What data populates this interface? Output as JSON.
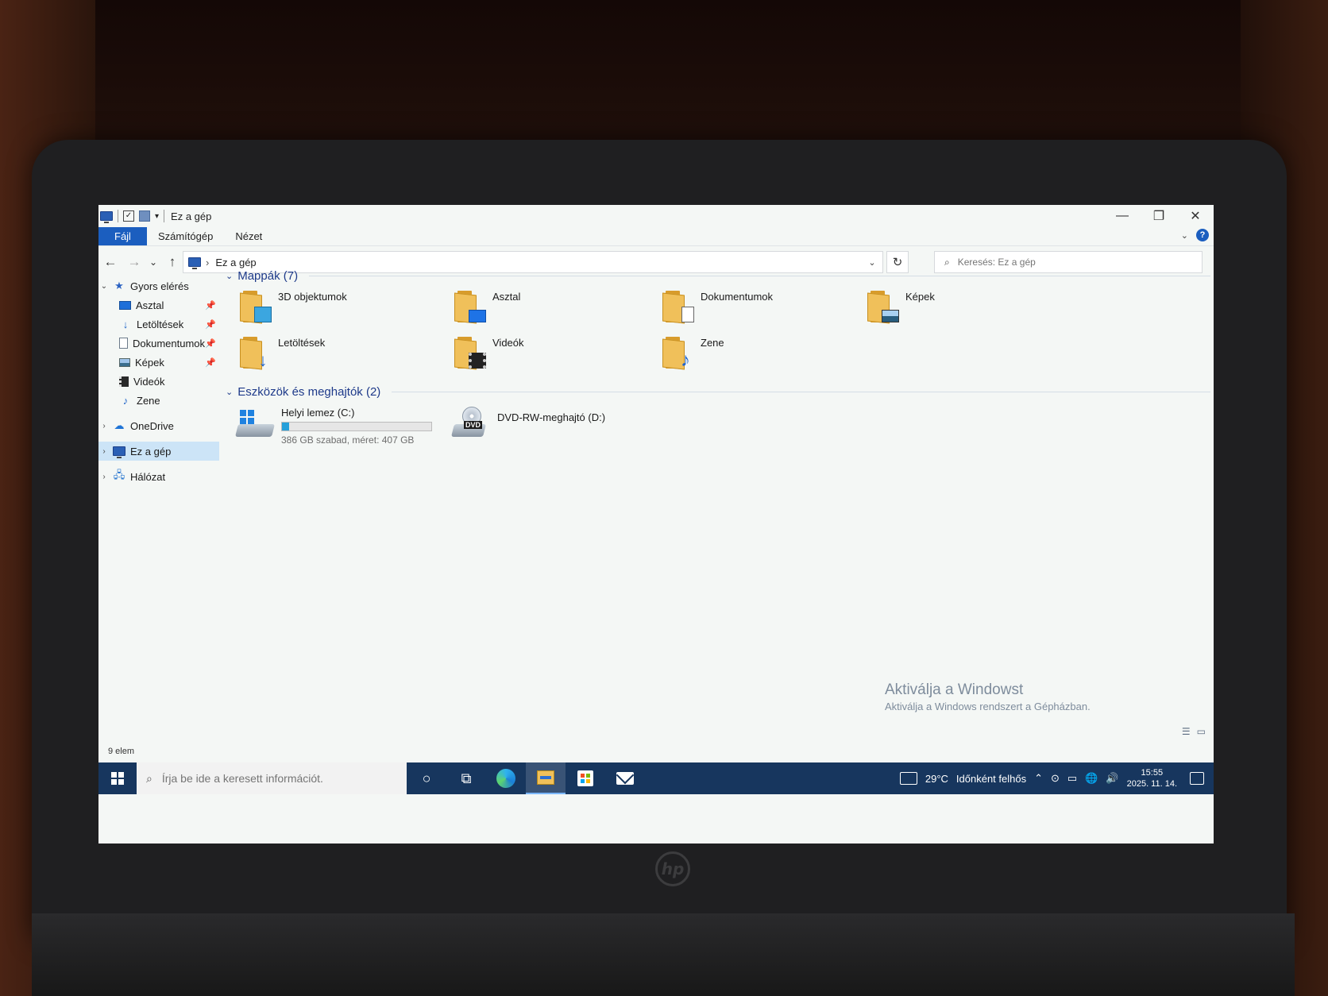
{
  "window": {
    "title": "Ez a gép",
    "controls": {
      "minimize": "—",
      "restore": "❐",
      "close": "✕"
    }
  },
  "ribbon": {
    "tabs": [
      "Fájl",
      "Számítógép",
      "Nézet"
    ],
    "help": "?"
  },
  "nav": {
    "back": "←",
    "forward": "→",
    "recent": "⌄",
    "up": "↑",
    "breadcrumb": "Ez a gép",
    "breadcrumb_sep": "›",
    "refresh": "↻",
    "search_placeholder": "Keresés: Ez a gép"
  },
  "sidebar": {
    "quick_access": "Gyors elérés",
    "quick_items": [
      {
        "label": "Asztal",
        "icon": "desktop-icon",
        "pinned": true
      },
      {
        "label": "Letöltések",
        "icon": "downloads-icon",
        "pinned": true
      },
      {
        "label": "Dokumentumok",
        "icon": "documents-icon",
        "pinned": true
      },
      {
        "label": "Képek",
        "icon": "pictures-icon",
        "pinned": true
      },
      {
        "label": "Videók",
        "icon": "videos-icon",
        "pinned": false
      },
      {
        "label": "Zene",
        "icon": "music-icon",
        "pinned": false
      }
    ],
    "onedrive": "OneDrive",
    "this_pc": "Ez a gép",
    "network": "Hálózat"
  },
  "content": {
    "folders_header": "Mappák (7)",
    "folders": [
      {
        "label": "3D objektumok",
        "icon": "3d-objects-folder-icon"
      },
      {
        "label": "Asztal",
        "icon": "desktop-folder-icon"
      },
      {
        "label": "Dokumentumok",
        "icon": "documents-folder-icon"
      },
      {
        "label": "Képek",
        "icon": "pictures-folder-icon"
      },
      {
        "label": "Letöltések",
        "icon": "downloads-folder-icon"
      },
      {
        "label": "Videók",
        "icon": "videos-folder-icon"
      },
      {
        "label": "Zene",
        "icon": "music-folder-icon"
      }
    ],
    "drives_header": "Eszközök és meghajtók (2)",
    "drives": [
      {
        "label": "Helyi lemez (C:)",
        "detail": "386 GB szabad, méret: 407 GB",
        "used_fraction": 0.05,
        "icon": "local-disk-icon"
      },
      {
        "label": "DVD-RW-meghajtó (D:)",
        "icon": "dvd-drive-icon",
        "dvd_label": "DVD"
      }
    ]
  },
  "status": {
    "item_count": "9 elem"
  },
  "watermark": {
    "title": "Aktiválja a Windowst",
    "subtitle": "Aktiválja a Windows rendszert a Gépházban."
  },
  "taskbar": {
    "search_placeholder": "Írja be ide a keresett információt.",
    "weather_temp": "29°C",
    "weather_desc": "Időnként felhős",
    "time": "15:55",
    "date": "2025. 11. 14."
  },
  "device": {
    "logo": "hp"
  },
  "colors": {
    "accent": "#1b5ebf",
    "taskbar": "#17365e",
    "selection": "#cce4f7",
    "disk_bar": "#26a0da"
  }
}
